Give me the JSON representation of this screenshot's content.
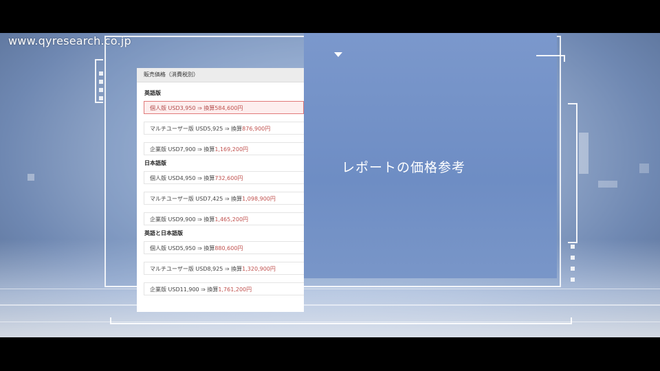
{
  "watermark": "www.qyresearch.co.jp",
  "slide_title": "レポートの価格参考",
  "panel": {
    "header": "販売価格（消費税別）",
    "sections": [
      {
        "title": "英語版",
        "rows": [
          {
            "label": "個人版 USD3,950 ⇒ 換算",
            "price": "584,600円",
            "selected": true
          },
          {
            "label": "マルチユーザー版 USD5,925 ⇒ 換算",
            "price": "876,900円"
          },
          {
            "label": "企業版 USD7,900 ⇒ 換算",
            "price": "1,169,200円"
          }
        ]
      },
      {
        "title": "日本語版",
        "rows": [
          {
            "label": "個人版 USD4,950 ⇒ 換算",
            "price": "732,600円"
          },
          {
            "label": "マルチユーザー版 USD7,425 ⇒ 換算",
            "price": "1,098,900円"
          },
          {
            "label": "企業版 USD9,900 ⇒ 換算",
            "price": "1,465,200円"
          }
        ]
      },
      {
        "title": "英語と日本語版",
        "rows": [
          {
            "label": "個人版 USD5,950 ⇒ 換算",
            "price": "880,600円"
          },
          {
            "label": "マルチユーザー版 USD8,925 ⇒ 換算",
            "price": "1,320,900円"
          },
          {
            "label": "企業版 USD11,900 ⇒ 換算",
            "price": "1,761,200円"
          }
        ]
      }
    ]
  },
  "colors": {
    "price_red": "#c0504d",
    "selected_border": "#e07a7a",
    "panel_header_bg": "#ececec"
  }
}
